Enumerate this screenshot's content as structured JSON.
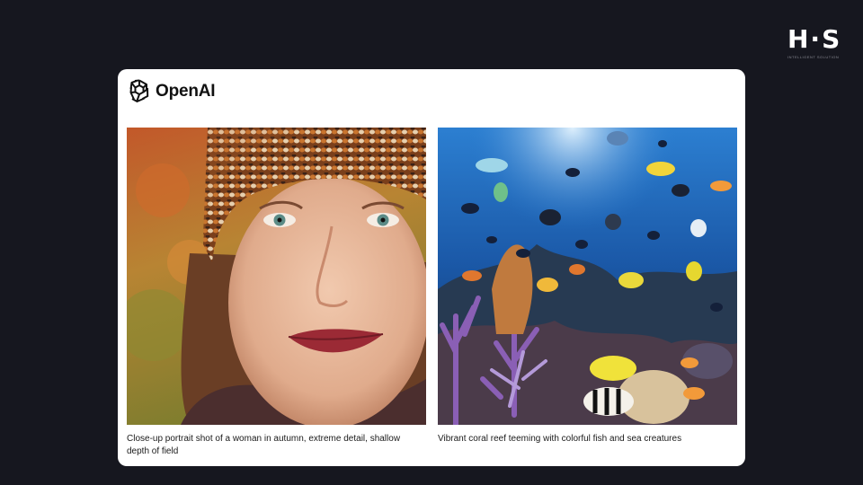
{
  "corner_logo": {
    "mark": "H·S",
    "subtext": "INTELLIGENT SOLUTION"
  },
  "brand": {
    "name": "OpenAI",
    "icon": "openai-logo-icon"
  },
  "images": [
    {
      "caption": "Close-up portrait shot of a woman in autumn, extreme detail, shallow depth of field",
      "subject": "portrait-woman-autumn"
    },
    {
      "caption": "Vibrant coral reef teeming with colorful fish and sea creatures",
      "subject": "coral-reef-fish"
    }
  ],
  "colors": {
    "page_background": "#16171f",
    "card_background": "#ffffff",
    "caption_text": "#1a1a1a"
  }
}
